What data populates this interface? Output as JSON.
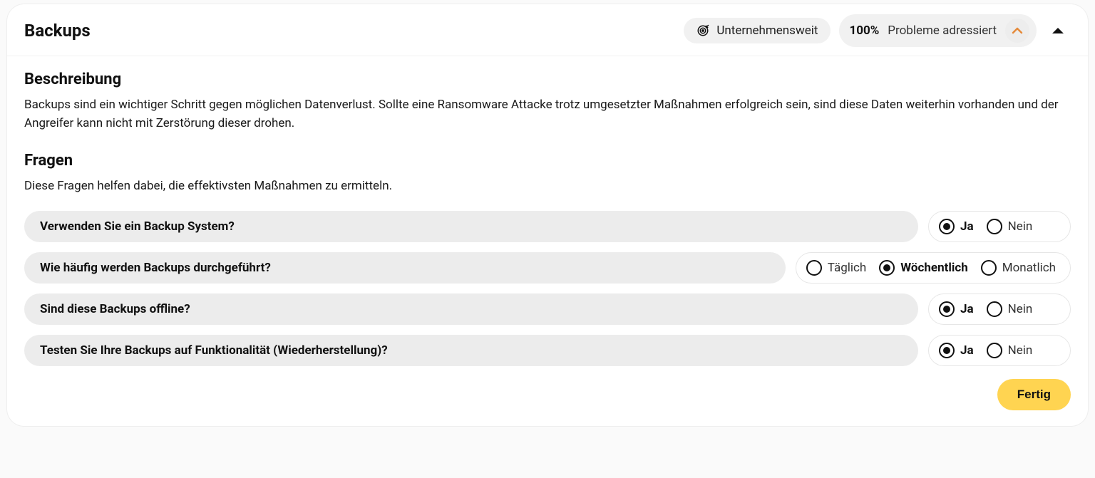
{
  "header": {
    "title": "Backups",
    "scope_chip": "Unternehmensweit",
    "progress_percent": "100%",
    "progress_label": "Probleme adressiert"
  },
  "description": {
    "heading": "Beschreibung",
    "text": "Backups sind ein wichtiger Schritt gegen möglichen Datenverlust. Sollte eine Ransomware Attacke trotz umgesetzter Maßnahmen erfolgreich sein, sind diese Daten weiterhin vorhanden und der Angreifer kann nicht mit Zerstörung dieser drohen."
  },
  "questions": {
    "heading": "Fragen",
    "intro": "Diese Fragen helfen dabei, die effektivsten Maßnahmen zu ermitteln.",
    "items": [
      {
        "label": "Verwenden Sie ein Backup System?",
        "options": [
          {
            "label": "Ja",
            "checked": true
          },
          {
            "label": "Nein",
            "checked": false
          }
        ]
      },
      {
        "label": "Wie häufig werden Backups durchgeführt?",
        "options": [
          {
            "label": "Täglich",
            "checked": false
          },
          {
            "label": "Wöchentlich",
            "checked": true
          },
          {
            "label": "Monatlich",
            "checked": false
          }
        ]
      },
      {
        "label": "Sind diese Backups offline?",
        "options": [
          {
            "label": "Ja",
            "checked": true
          },
          {
            "label": "Nein",
            "checked": false
          }
        ]
      },
      {
        "label": "Testen Sie Ihre Backups auf Funktionalität (Wiederherstellung)?",
        "options": [
          {
            "label": "Ja",
            "checked": true
          },
          {
            "label": "Nein",
            "checked": false
          }
        ]
      }
    ]
  },
  "footer": {
    "done_label": "Fertig"
  },
  "colors": {
    "accent_yellow": "#ffd451",
    "chevron_orange": "#e58a3a"
  }
}
